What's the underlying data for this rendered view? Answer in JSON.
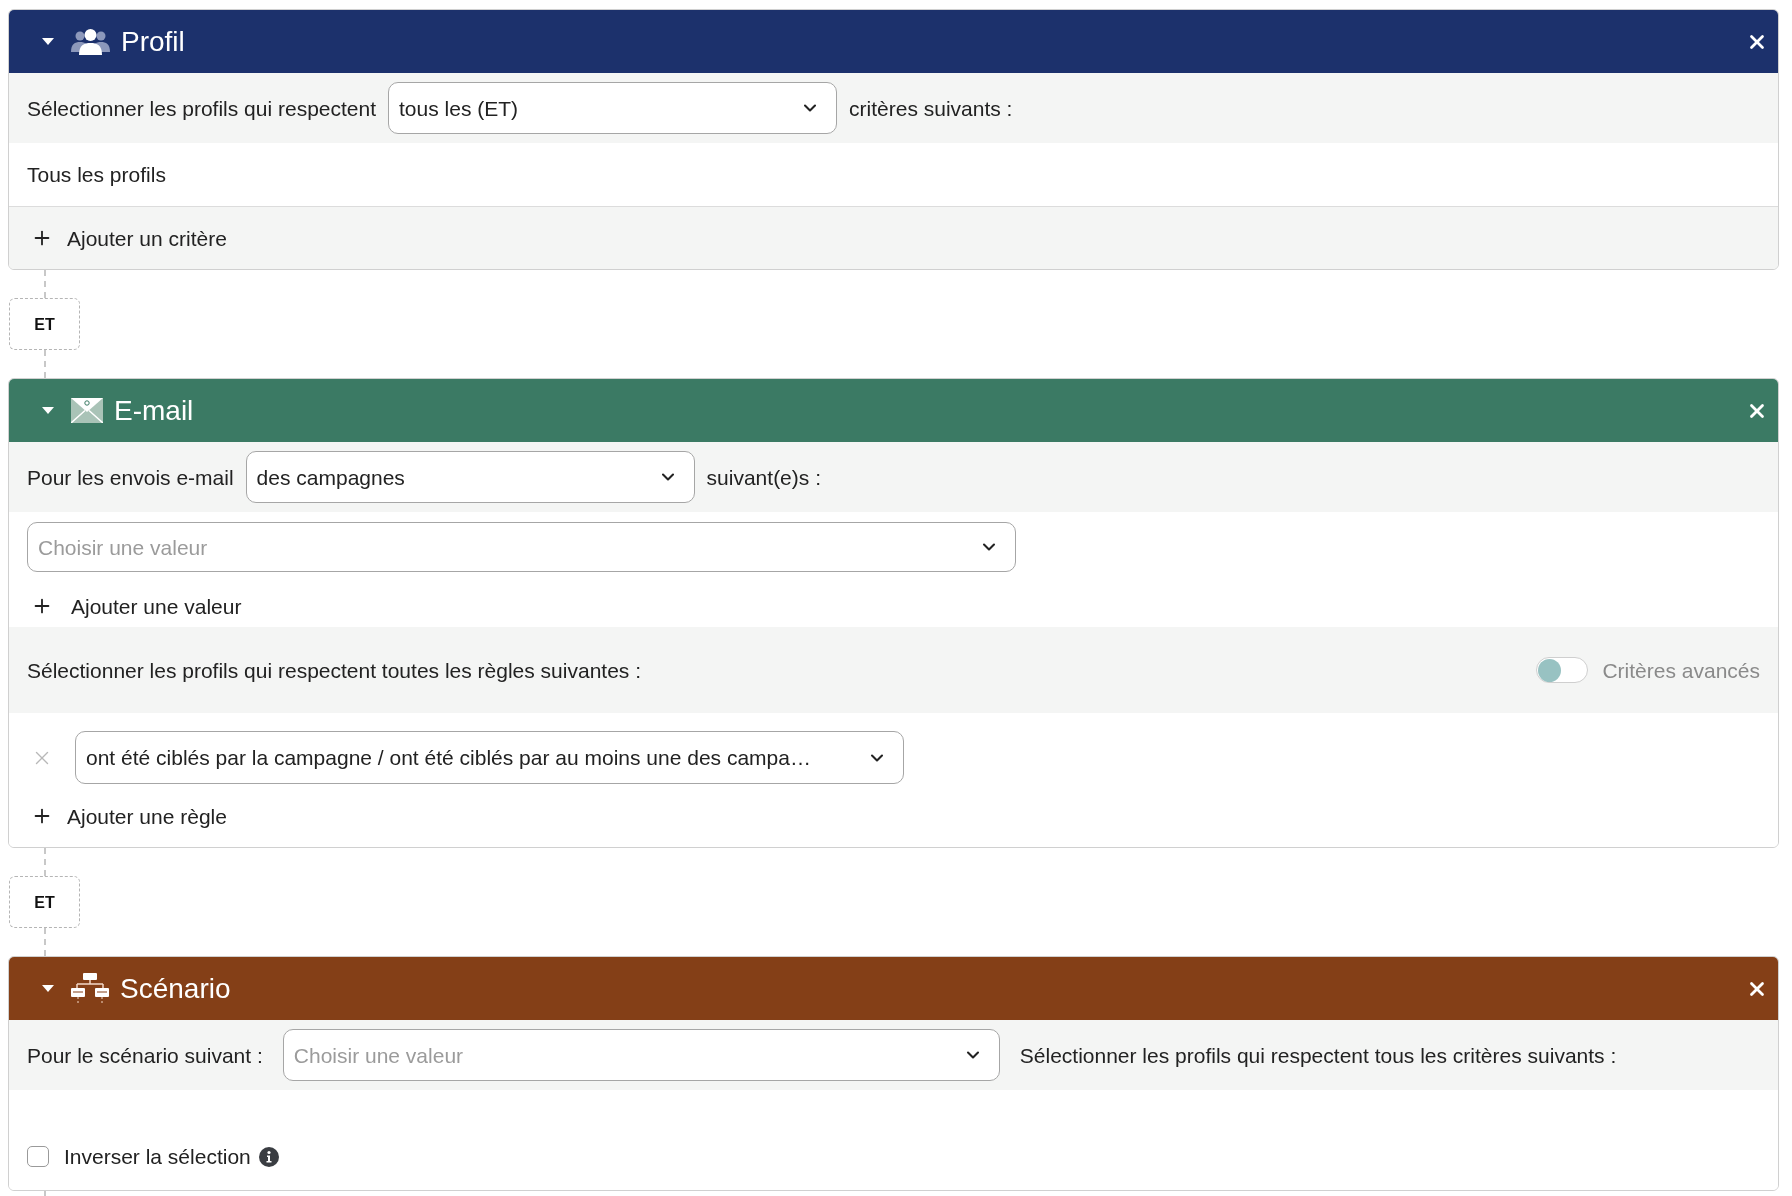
{
  "blocks": [
    {
      "kind": "profile",
      "title": "Profil",
      "color": "#1c316c",
      "expanded": true,
      "match_rule": {
        "label": "Sélectionner les profils qui respectent",
        "select": {
          "value": "tous les (ET)"
        },
        "suffix": "critères suivants :"
      },
      "summary": "Tous les profils",
      "add_criterion": "Ajouter un critère"
    },
    {
      "kind": "operator",
      "label": "ET"
    },
    {
      "kind": "email",
      "title": "E-mail",
      "color": "#3b7a64",
      "expanded": true,
      "sends": {
        "label": "Pour les envois e-mail",
        "select": {
          "value": "des campagnes"
        },
        "suffix": "suivant(e)s :"
      },
      "value_select": {
        "placeholder": "Choisir une valeur"
      },
      "add_value": "Ajouter une valeur",
      "rules_intro": "Sélectionner les profils qui respectent toutes les règles suivantes :",
      "advanced_toggle": {
        "label": "Critères avancés",
        "on": false
      },
      "rules": [
        {
          "select": {
            "value": "ont été ciblés par la campagne / ont été ciblés par au moins une des campa…"
          }
        }
      ],
      "add_rule": "Ajouter une règle"
    },
    {
      "kind": "operator",
      "label": "ET"
    },
    {
      "kind": "scenario",
      "title": "Scénario",
      "color": "#843f17",
      "expanded": true,
      "scenario_select": {
        "label": "Pour le scénario suivant :",
        "select": {
          "placeholder": "Choisir une valeur"
        },
        "suffix": "Sélectionner les profils qui respectent tous les critères suivants :"
      },
      "invert": {
        "label": "Inverser la sélection",
        "checked": false
      }
    }
  ]
}
